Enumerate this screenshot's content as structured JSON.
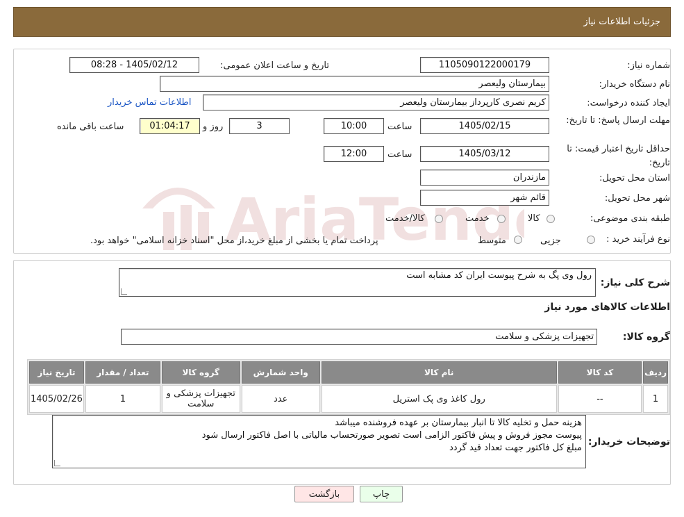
{
  "header": {
    "title": "جزئیات اطلاعات نیاز"
  },
  "fields": {
    "need_number_label": "شماره نیاز:",
    "need_number": "1105090122000179",
    "announce_label": "تاریخ و ساعت اعلان عمومی:",
    "announce_value": "1405/02/12 - 08:28",
    "buyer_org_label": "نام دستگاه خریدار:",
    "buyer_org": "بیمارستان ولیعصر",
    "requester_label": "ایجاد کننده درخواست:",
    "requester": "کریم نصری کارپرداز بیمارستان ولیعصر",
    "contact_link": "اطلاعات تماس خریدار",
    "deadline_label": "مهلت ارسال پاسخ: تا تاریخ:",
    "deadline_date": "1405/02/15",
    "time_label": "ساعت",
    "deadline_time": "10:00",
    "days": "3",
    "days_label": "روز و",
    "remaining_time": "01:04:17",
    "remaining_label": "ساعت باقی مانده",
    "validity_label": "حداقل تاریخ اعتبار قیمت: تا تاریخ:",
    "validity_date": "1405/03/12",
    "validity_time": "12:00",
    "province_label": "استان محل تحویل:",
    "province": "مازندران",
    "city_label": "شهر محل تحویل:",
    "city": "قائم شهر",
    "category_label": "طبقه بندی موضوعی:",
    "category_options": [
      "کالا",
      "خدمت",
      "کالا/خدمت"
    ],
    "process_label": "نوع فرآیند خرید :",
    "process_options": [
      "جزیی",
      "متوسط"
    ],
    "process_note": "پرداخت تمام یا بخشی از مبلغ خرید،از محل \"اسناد خزانه اسلامی\" خواهد بود."
  },
  "summary": {
    "label": "شرح کلی نیاز:",
    "value": "رول وی پگ به شرح پیوست  ایران کد مشابه است",
    "goods_title": "اطلاعات کالاهای مورد نیاز",
    "group_label": "گروه کالا:",
    "group_value": "تجهیزات پزشکی و سلامت"
  },
  "table": {
    "headers": [
      "ردیف",
      "کد کالا",
      "نام کالا",
      "واحد شمارش",
      "گروه کالا",
      "تعداد / مقدار",
      "تاریخ نیاز"
    ],
    "rows": [
      [
        "1",
        "--",
        "رول کاغذ وی پک استریل",
        "عدد",
        "تجهیزات پزشکی و سلامت",
        "1",
        "1405/02/26"
      ]
    ]
  },
  "notes": {
    "label": "توضیحات خریدار:",
    "lines": [
      "هزینه حمل و تخلیه کالا تا انبار بیمارستان بر عهده فروشنده میباشد",
      "پیوست مجوز فروش و پیش فاکتور الزامی است  تصویر صورتحساب مالیاتی با اصل فاکتور ارسال شود",
      "مبلغ کل فاکتور جهت تعداد قید گردد"
    ]
  },
  "buttons": {
    "print": "چاپ",
    "back": "بازگشت"
  },
  "watermark": {
    "text": "AriaTender.neT"
  },
  "colors": {
    "header_bg": "#8a6a3b",
    "link": "#1a55c4",
    "print_bg": "#eaffea",
    "back_bg": "#ffe6e6"
  }
}
